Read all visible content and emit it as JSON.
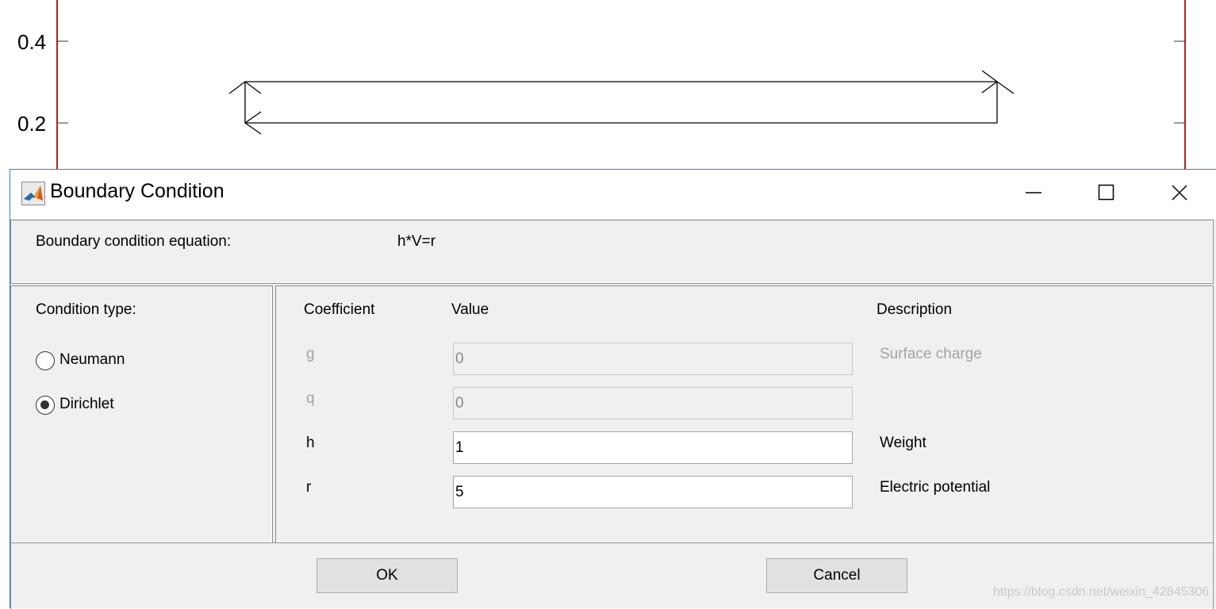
{
  "plot": {
    "y_ticks": [
      "0.4",
      "0.2"
    ],
    "axis_color": "#b22222"
  },
  "dialog": {
    "title": "Boundary Condition",
    "app_icon": "matlab-icon",
    "window_controls": [
      "minimize-icon",
      "maximize-icon",
      "close-icon"
    ],
    "equation": {
      "label": "Boundary condition equation:",
      "value": "h*V=r"
    },
    "condition_type": {
      "label": "Condition type:",
      "options": [
        {
          "label": "Neumann",
          "selected": false
        },
        {
          "label": "Dirichlet",
          "selected": true
        }
      ]
    },
    "coefficients": {
      "headers": {
        "coefficient": "Coefficient",
        "value": "Value",
        "description": "Description"
      },
      "rows": [
        {
          "name": "g",
          "value": "0",
          "description": "Surface charge",
          "enabled": false
        },
        {
          "name": "q",
          "value": "0",
          "description": "",
          "enabled": false
        },
        {
          "name": "h",
          "value": "1",
          "description": "Weight",
          "enabled": true
        },
        {
          "name": "r",
          "value": "5",
          "description": "Electric potential",
          "enabled": true
        }
      ]
    },
    "buttons": {
      "ok": "OK",
      "cancel": "Cancel"
    }
  },
  "watermark": "https://blog.csdn.net/weixin_42845306"
}
